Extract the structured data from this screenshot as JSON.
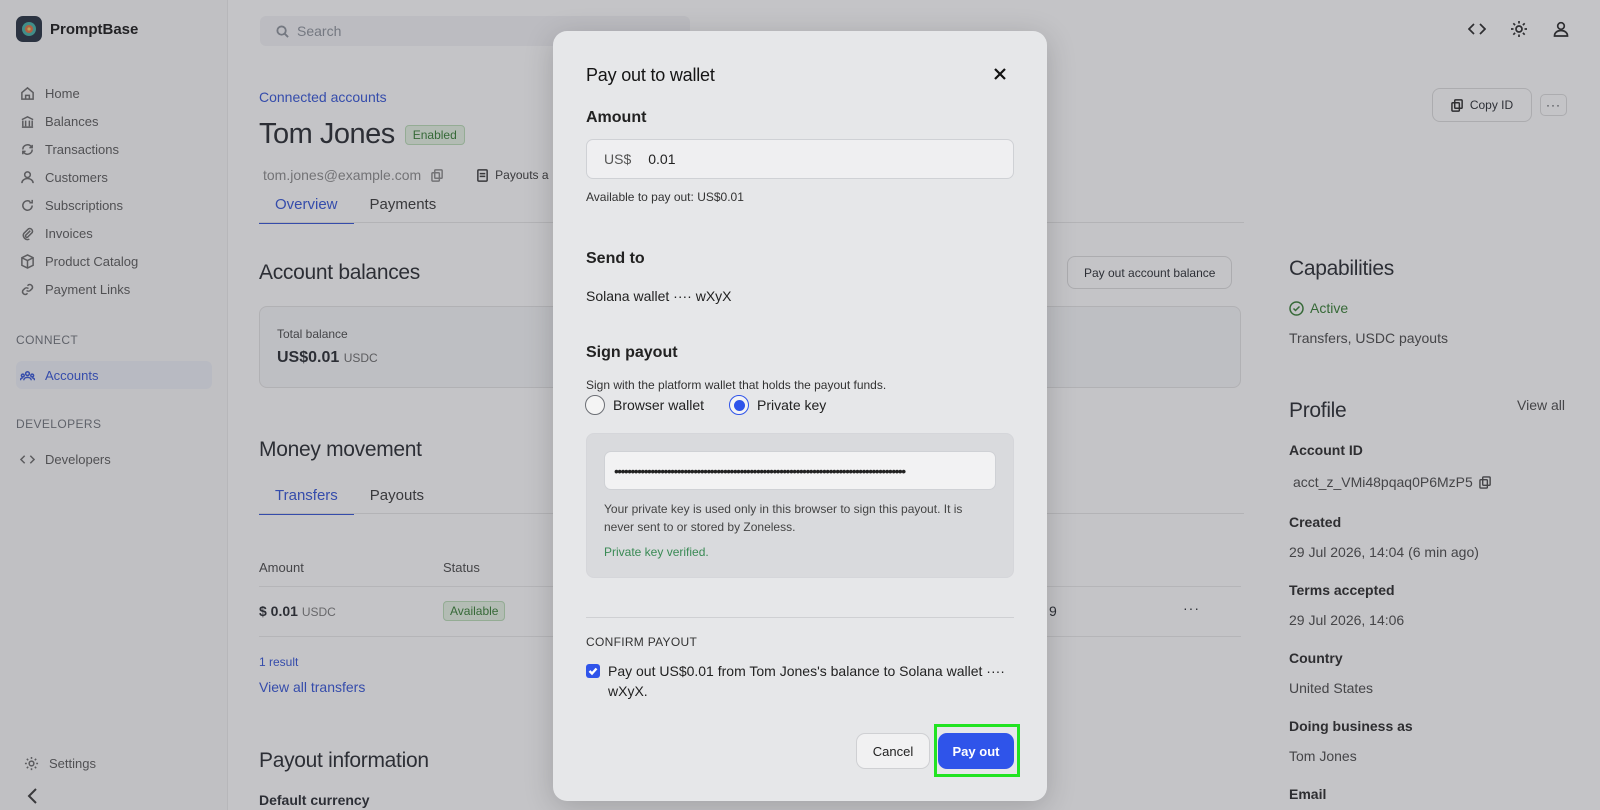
{
  "app": {
    "name": "PromptBase"
  },
  "sidebar": {
    "items": [
      {
        "label": "Home",
        "icon": "home-icon"
      },
      {
        "label": "Balances",
        "icon": "bank-icon"
      },
      {
        "label": "Transactions",
        "icon": "refresh-icon"
      },
      {
        "label": "Customers",
        "icon": "user-icon"
      },
      {
        "label": "Subscriptions",
        "icon": "cycle-icon"
      },
      {
        "label": "Invoices",
        "icon": "paperclip-icon"
      },
      {
        "label": "Product Catalog",
        "icon": "box-icon"
      },
      {
        "label": "Payment Links",
        "icon": "link-icon"
      }
    ],
    "connect_heading": "CONNECT",
    "accounts_label": "Accounts",
    "developers_heading": "DEVELOPERS",
    "developers_label": "Developers",
    "settings_label": "Settings"
  },
  "topbar": {
    "search_placeholder": "Search"
  },
  "account": {
    "breadcrumb": "Connected accounts",
    "name": "Tom Jones",
    "status": "Enabled",
    "email": "tom.jones@example.com",
    "payouts_meta": "Payouts a",
    "tabs": [
      "Overview",
      "Payments"
    ]
  },
  "balances": {
    "title": "Account balances",
    "payout_button": "Pay out account balance",
    "total_label": "Total balance",
    "total_value": "US$0.01",
    "total_unit": "USDC"
  },
  "money_movement": {
    "title": "Money movement",
    "tabs": [
      "Transfers",
      "Payouts"
    ],
    "col_amount": "Amount",
    "col_status": "Status",
    "row": {
      "amount": "$ 0.01",
      "unit": "USDC",
      "status": "Available",
      "trailing": "9",
      "menu": "···"
    },
    "result_count": "1 result",
    "view_all": "View all transfers"
  },
  "payout_info": {
    "title": "Payout information",
    "default_currency": "Default currency"
  },
  "right": {
    "copy_id": "Copy ID",
    "more": "···",
    "capabilities_title": "Capabilities",
    "capabilities_status": "Active",
    "capabilities_text": "Transfers, USDC payouts",
    "profile_title": "Profile",
    "view_all": "View all",
    "account_id_label": "Account ID",
    "account_id": "acct_z_VMi48pqaq0P6MzP5",
    "created_label": "Created",
    "created": "29 Jul 2026, 14:04 (6 min ago)",
    "terms_label": "Terms accepted",
    "terms": "29 Jul 2026, 14:06",
    "country_label": "Country",
    "country": "United States",
    "dba_label": "Doing business as",
    "dba": "Tom Jones",
    "email_label": "Email"
  },
  "modal": {
    "title": "Pay out to wallet",
    "amount_label": "Amount",
    "currency": "US$",
    "amount_value": "0.01",
    "available": "Available to pay out: US$0.01",
    "send_to_label": "Send to",
    "send_to_value": "Solana wallet ···· wXyX",
    "sign_label": "Sign payout",
    "sign_help": "Sign with the platform wallet that holds the payout funds.",
    "radio_browser": "Browser wallet",
    "radio_private": "Private key",
    "selected_method": "Private key",
    "key_mask": "••••••••••••••••••••••••••••••••••••••••••••••••••••••••••••••••••••••••••••••••••••••••",
    "key_note": "Your private key is used only in this browser to sign this payout. It is never sent to or stored by Zoneless.",
    "key_verified": "Private key verified.",
    "confirm_heading": "CONFIRM PAYOUT",
    "confirm_text": "Pay out US$0.01 from Tom Jones's balance to Solana wallet ···· wXyX.",
    "confirm_checked": true,
    "cancel": "Cancel",
    "pay_out": "Pay out"
  },
  "colors": {
    "accent": "#2f54ea",
    "success": "#2f7a2c",
    "highlight": "#21e321"
  }
}
